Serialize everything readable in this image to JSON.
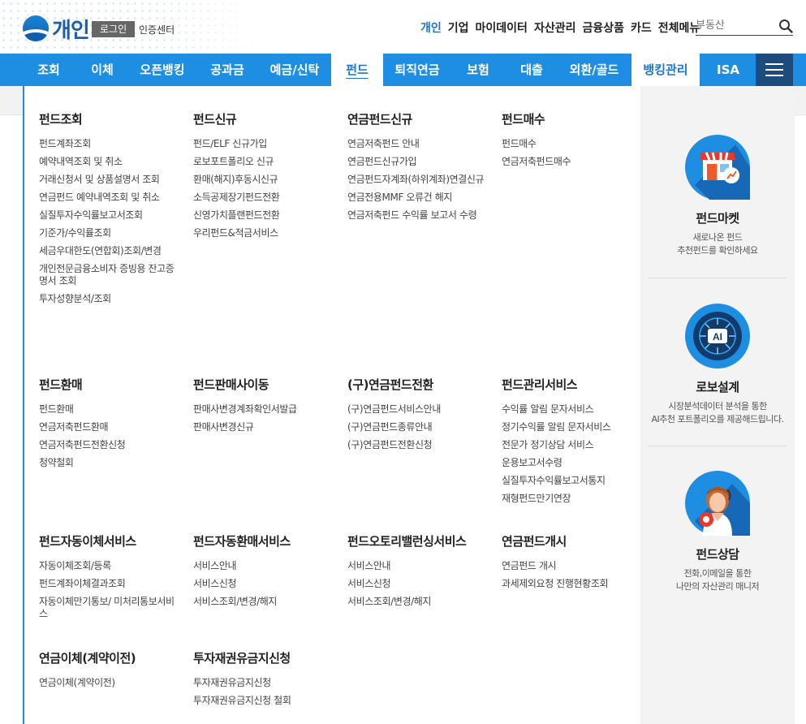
{
  "header": {
    "brand": "개인",
    "login_label": "로그인",
    "cert_label": "인증센터",
    "top_menu": [
      "개인",
      "기업",
      "마이데이터",
      "자산관리",
      "금융상품",
      "카드",
      "전체메뉴"
    ],
    "search_placeholder": "부동산"
  },
  "main_nav": [
    "조회",
    "이체",
    "오픈뱅킹",
    "공과금",
    "예금/신탁",
    "펀드",
    "퇴직연금",
    "보험",
    "대출",
    "외환/골드",
    "뱅킹관리",
    "ISA"
  ],
  "menu": {
    "sections": [
      {
        "title": "펀드조회",
        "items": [
          "펀드계좌조회",
          "예약내역조회 및 취소",
          "거래신청서 및 상품설명서 조회",
          "연금펀드 예약내역조회 및 취소",
          "실질투자수익률보고서조회",
          "기준가/수익률조회",
          "세금우대한도(연합회)조회/변경",
          "개인전문금융소비자 증빙용 잔고증명서 조회",
          "투자성향분석/조회"
        ]
      },
      {
        "title": "펀드신규",
        "items": [
          "펀드/ELF 신규가입",
          "로보포트폴리오 신규",
          "환매(해지)후동시신규",
          "소득공제장기펀드전환",
          "신영가치플랜펀드전환",
          "우리펀드&적금서비스"
        ]
      },
      {
        "title": "연금펀드신규",
        "items": [
          "연금저축펀드 안내",
          "연금펀드신규가입",
          "연금펀드자계좌(하위계좌)연결신규",
          "연금전용MMF 오류건 해지",
          "연금저축펀드 수익률 보고서 수령"
        ]
      },
      {
        "title": "펀드매수",
        "items": [
          "펀드매수",
          "연금저축펀드매수"
        ]
      },
      {
        "title": "펀드환매",
        "items": [
          "펀드환매",
          "연금저축펀드환매",
          "연금저축펀드전환신청",
          "청약철회"
        ]
      },
      {
        "title": "펀드판매사이동",
        "items": [
          "판매사변경계좌확인서발급",
          "판매사변경신규"
        ]
      },
      {
        "title": "(구)연금펀드전환",
        "items": [
          "(구)연금펀드서비스안내",
          "(구)연금펀드종류안내",
          "(구)연금펀드전환신청"
        ]
      },
      {
        "title": "펀드관리서비스",
        "items": [
          "수익률 알림 문자서비스",
          "정기수익률 알림 문자서비스",
          "전문가 정기상담 서비스",
          "운용보고서수령",
          "실질투자수익률보고서통지",
          "재형펀드만기연장"
        ]
      },
      {
        "title": "펀드자동이체서비스",
        "items": [
          "자동이체조회/등록",
          "펀드계좌이체결과조회",
          "자동이체만기통보/ 미처리통보서비스"
        ]
      },
      {
        "title": "펀드자동환매서비스",
        "items": [
          "서비스안내",
          "서비스신청",
          "서비스조회/변경/해지"
        ]
      },
      {
        "title": "펀드오토리밸런싱서비스",
        "items": [
          "서비스안내",
          "서비스신청",
          "서비스조회/변경/해지"
        ]
      },
      {
        "title": "연금펀드개시",
        "items": [
          "연금펀드 개시",
          "과세제외요청 진행현황조회"
        ]
      },
      {
        "title": "연금이체(계약이전)",
        "items": [
          "연금이체(계약이전)"
        ]
      },
      {
        "title": "투자재권유금지신청",
        "items": [
          "투자재권유금지신청",
          "투자재권유금지신청 철회"
        ]
      }
    ]
  },
  "promos": [
    {
      "title": "펀드마켓",
      "line1": "새로나온 펀드",
      "line2": "추천펀드를 확인하세요",
      "icon": "store-icon"
    },
    {
      "title": "로보설계",
      "line1": "시장분석데이터 분석을 통한",
      "line2": "AI추천 포트폴리오를 제공해드립니다.",
      "icon": "ai-chip-icon",
      "badge": "AI"
    },
    {
      "title": "펀드상담",
      "line1": "전화,이메일을 통한",
      "line2": "나만의 자산관리 매니저",
      "icon": "counselor-icon"
    }
  ],
  "colors": {
    "primary": "#1e8ee3",
    "nav_dark": "#1d4b7d",
    "brand": "#1a5fae",
    "side_bg": "#f3f3f3"
  }
}
